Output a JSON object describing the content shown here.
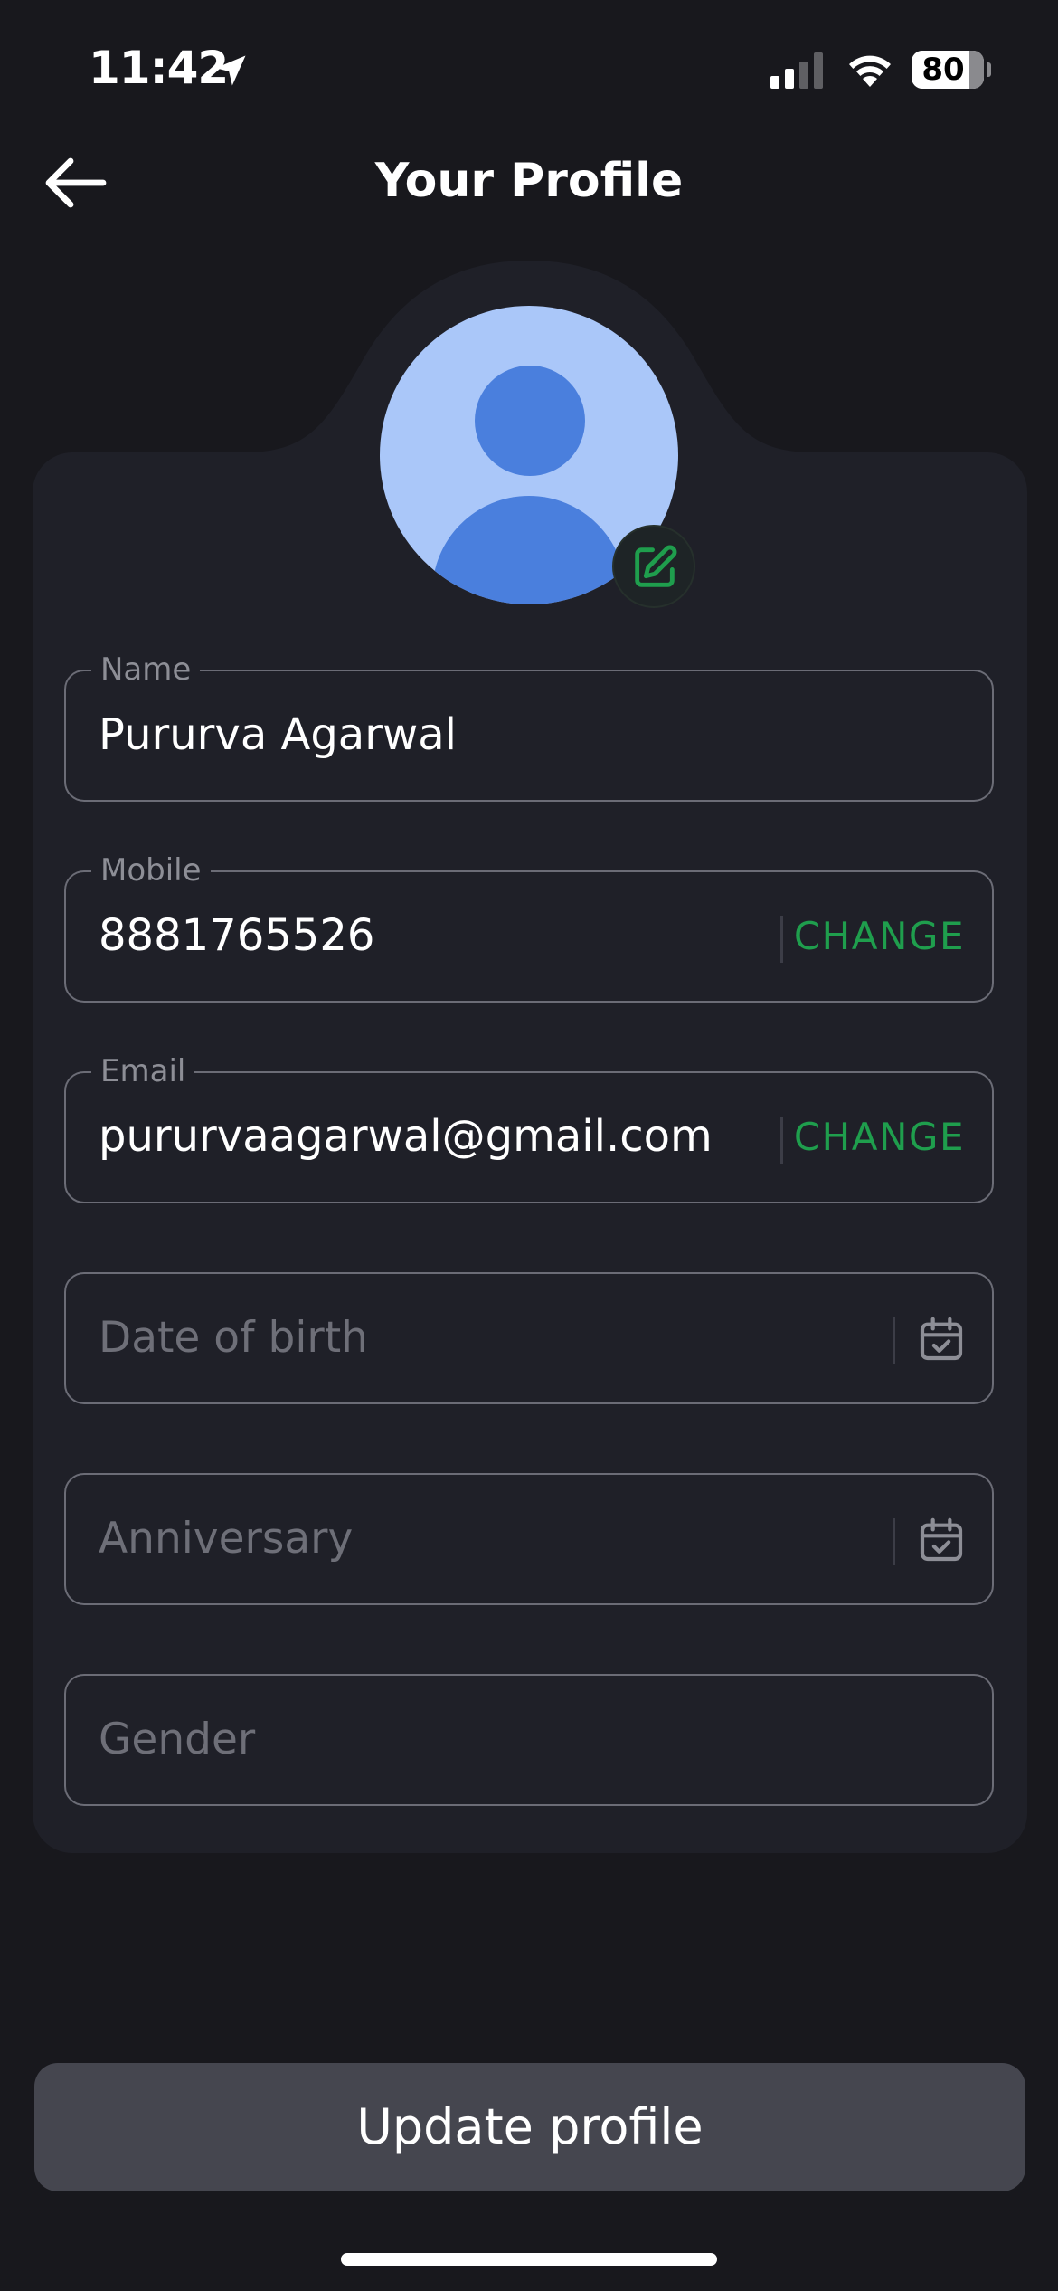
{
  "status_bar": {
    "time": "11:42",
    "battery_level": "80",
    "icons": [
      "location-arrow-icon",
      "cellular-signal-icon",
      "wifi-icon",
      "battery-icon"
    ]
  },
  "header": {
    "title": "Your Profile",
    "back_icon": "arrow-left-icon"
  },
  "avatar": {
    "edit_icon": "edit-pencil-icon"
  },
  "form": {
    "name": {
      "label": "Name",
      "value": "Pururva Agarwal"
    },
    "mobile": {
      "label": "Mobile",
      "value": "8881765526",
      "action": "CHANGE"
    },
    "email": {
      "label": "Email",
      "value": "pururvaagarwal@gmail.com",
      "action": "CHANGE"
    },
    "dob": {
      "placeholder": "Date of birth",
      "icon": "calendar-check-icon"
    },
    "anniversary": {
      "placeholder": "Anniversary",
      "icon": "calendar-check-icon"
    },
    "gender": {
      "placeholder": "Gender"
    }
  },
  "footer": {
    "update_label": "Update profile"
  },
  "colors": {
    "background": "#18181d",
    "card": "#1f2028",
    "accent_green": "#1f9e4d",
    "button": "#45464f",
    "avatar_light": "#aac7f9",
    "avatar_dark": "#4a7fdd"
  }
}
